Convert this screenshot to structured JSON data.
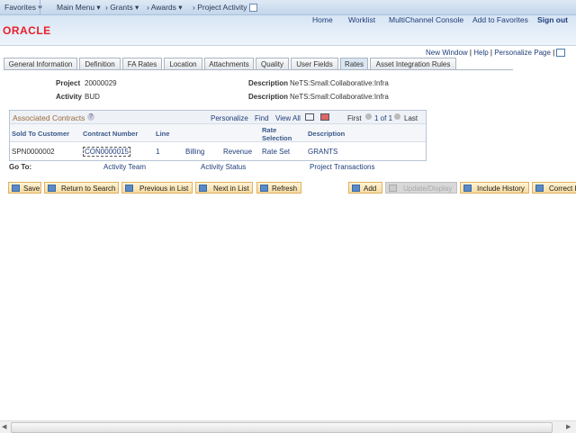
{
  "nav": {
    "favorites": "Favorites ▾",
    "main_menu": "Main Menu ▾",
    "grants": "› Grants ▾",
    "awards": "› Awards ▾",
    "current": "› Project Activity"
  },
  "header_links": [
    "Home",
    "Worklist",
    "MultiChannel Console",
    "Add to Favorites",
    "Sign out"
  ],
  "logo": "ORACLE",
  "page_links": {
    "new_window": "New Window",
    "help": "Help",
    "personalize": "Personalize Page"
  },
  "tabs": [
    "General Information",
    "Definition",
    "FA Rates",
    "Location",
    "Attachments",
    "Quality",
    "User Fields",
    "Rates",
    "Asset Integration Rules"
  ],
  "active_tab": "Rates",
  "fields": {
    "project_label": "Project",
    "project_value": "20000029",
    "activity_label": "Activity",
    "activity_value": "BUD",
    "desc_label": "Description",
    "desc1": "NeTS:Small:Collaborative:Infra",
    "desc2": "NeTS:Small:Collaborative:Infra"
  },
  "grid": {
    "title": "Associated Contracts",
    "personalize": "Personalize",
    "find": "Find",
    "view_all": "View All",
    "first": "First",
    "count": "1 of 1",
    "last": "Last",
    "columns": [
      "Sold To Customer",
      "Contract Number",
      "Line",
      "",
      "",
      "Rate Selection",
      "Description"
    ],
    "rows": [
      {
        "customer": "SPN0000002",
        "contract": "CON0000015",
        "line": "1",
        "billing": "Billing",
        "revenue": "Revenue",
        "rate": "Rate Set",
        "desc": "GRANTS"
      }
    ]
  },
  "goto": {
    "label": "Go To:",
    "links": [
      "Activity Team",
      "Activity Status",
      "Project Transactions"
    ]
  },
  "buttons": [
    "Save",
    "Return to Search",
    "Previous in List",
    "Next in List",
    "Refresh",
    "Add",
    "Update/Display",
    "Include History",
    "Correct History"
  ]
}
